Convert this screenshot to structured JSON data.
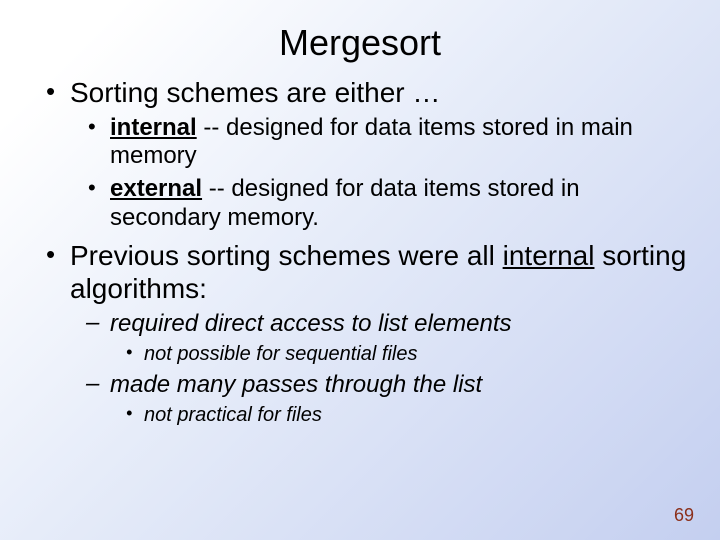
{
  "title": "Mergesort",
  "bullets": {
    "a": {
      "text": "Sorting schemes are either …"
    },
    "a1": {
      "lead": "internal",
      "rest": " -- designed for data items stored in main memory"
    },
    "a2": {
      "lead": "external",
      "rest": " -- designed for data items stored in secondary memory."
    },
    "b": {
      "pre": "Previous sorting schemes were all ",
      "u": "internal",
      "post": " sorting algorithms:"
    },
    "b1": {
      "text": "required direct access to list elements"
    },
    "b1a": {
      "text": "not possible for sequential files"
    },
    "b2": {
      "text": "made many passes through the list"
    },
    "b2a": {
      "text": "not practical for files"
    }
  },
  "page_number": "69"
}
